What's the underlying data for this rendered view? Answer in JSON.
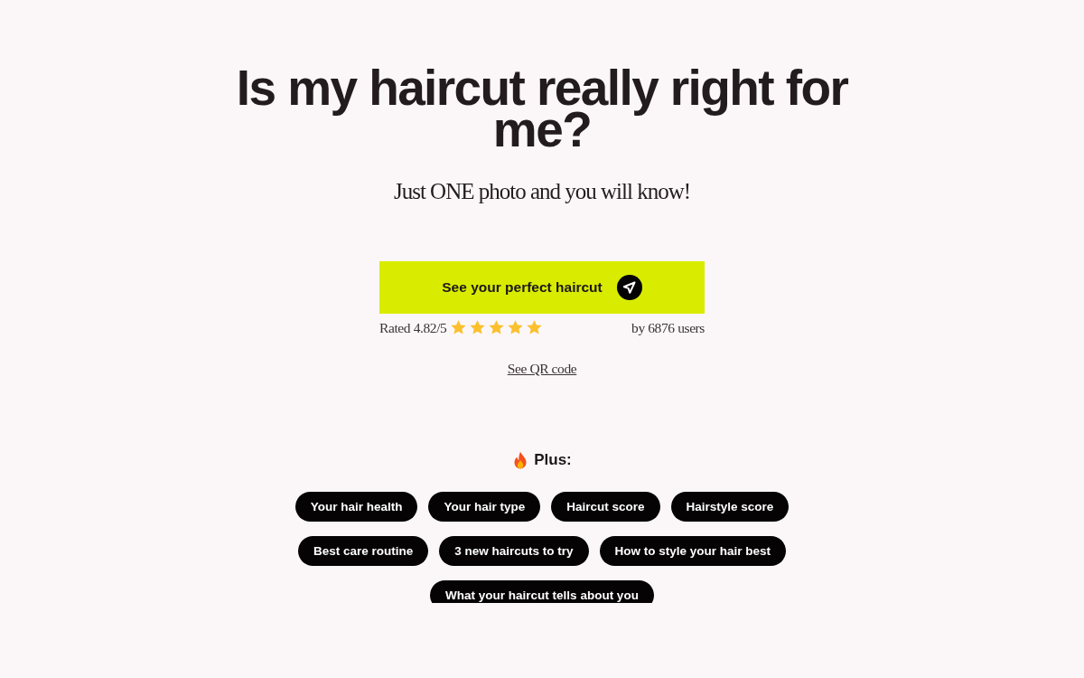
{
  "headline": "Is my haircut really right for me?",
  "subtitle": "Just ONE photo and you will know!",
  "cta": {
    "label": "See your perfect haircut"
  },
  "rating": {
    "text": "Rated 4.82/5",
    "stars": 5,
    "count": "by 6876 users"
  },
  "qr_link": "See QR code",
  "plus": {
    "heading": "Plus:",
    "features": [
      "Your hair health",
      "Your hair type",
      "Haircut score",
      "Hairstyle score",
      "Best care routine",
      "3 new haircuts to try",
      "How to style your hair best",
      "What your haircut tells about you"
    ]
  }
}
